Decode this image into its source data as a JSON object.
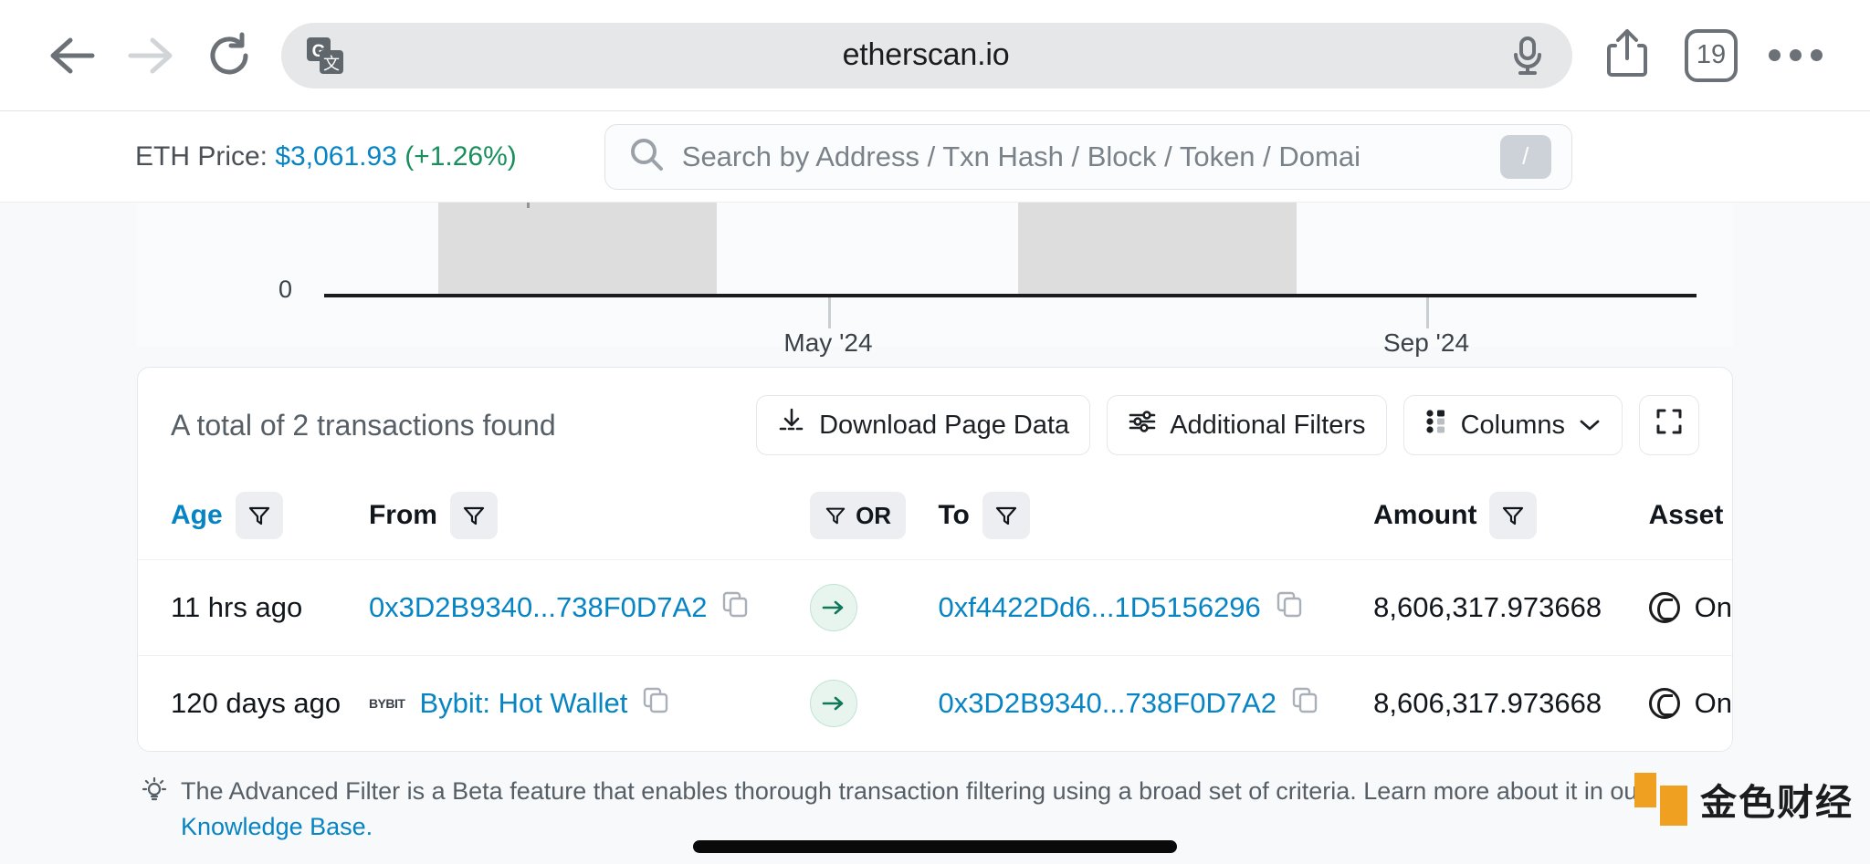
{
  "browser": {
    "back_label": "Back",
    "forward_label": "Forward",
    "reload_label": "Reload",
    "translate_label": "Translate page",
    "url": "etherscan.io",
    "mic_label": "Voice search",
    "share_label": "Share",
    "tab_count": "19",
    "more_label": "More"
  },
  "site_header": {
    "eth_price_label": "ETH Price:",
    "eth_price_value": "$3,061.93",
    "eth_price_change": "(+1.26%)",
    "search_placeholder": "Search by Address / Txn Hash / Block / Token / Domai",
    "search_shortcut": "/"
  },
  "chart": {
    "y_zero": "0",
    "x_labels": [
      "May '24",
      "Sep '24"
    ]
  },
  "chart_data": {
    "type": "bar",
    "title": "",
    "xlabel": "",
    "ylabel": "",
    "categories": [
      "May '24",
      "Sep '24"
    ],
    "values": [
      0,
      0
    ],
    "ylim": [
      0,
      1
    ],
    "yticks": [
      "0"
    ],
    "xticks": [
      "May '24",
      "Sep '24"
    ],
    "grid": false,
    "legend": "none",
    "note": "Only the bottom portion of the chart is visible; shaded gray background bands span the plot area with a baseline at 0."
  },
  "results": {
    "total_text": "A total of 2 transactions found",
    "download_label": "Download Page Data",
    "filters_label": "Additional Filters",
    "columns_label": "Columns",
    "fullscreen_label": "Fullscreen"
  },
  "table": {
    "headers": {
      "age": "Age",
      "from": "From",
      "or": "OR",
      "to": "To",
      "amount": "Amount",
      "asset": "Asset"
    },
    "rows": [
      {
        "age": "11 hrs ago",
        "from": "0x3D2B9340...738F0D7A2",
        "from_tag": "",
        "to": "0xf4422Dd6...1D5156296",
        "amount": "8,606,317.973668",
        "asset": "On"
      },
      {
        "age": "120 days ago",
        "from": "Bybit: Hot Wallet",
        "from_tag": "BYBIT",
        "to": "0x3D2B9340...738F0D7A2",
        "amount": "8,606,317.973668",
        "asset": "On"
      }
    ]
  },
  "footer": {
    "note_text": "The Advanced Filter is a Beta feature that enables thorough transaction filtering using a broad set of criteria. Learn more about it in our",
    "note_link": "Knowledge Base."
  },
  "watermark": {
    "text": "金色财经"
  },
  "colors": {
    "link": "#0784c3",
    "positive": "#1a8f5e",
    "accent_badge": "#e7f5ee",
    "page_bg": "#f7f9fb"
  }
}
